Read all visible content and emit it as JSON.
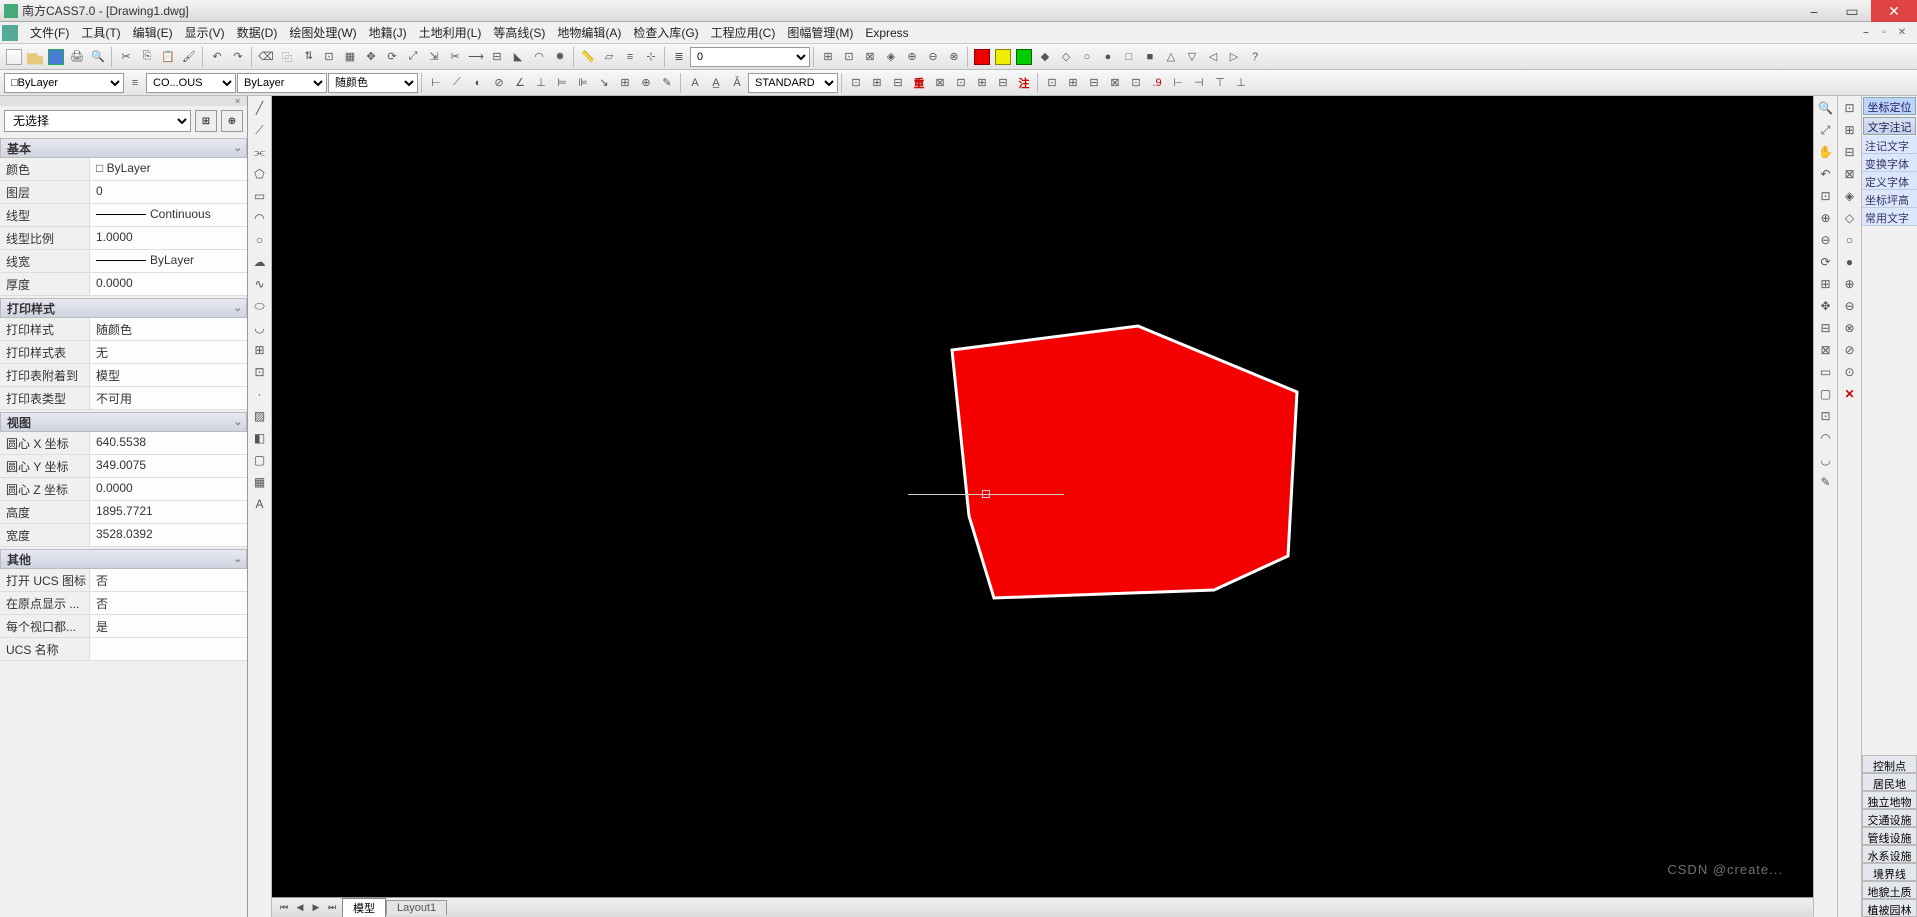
{
  "window": {
    "title": "南方CASS7.0 - [Drawing1.dwg]"
  },
  "menu": [
    "文件(F)",
    "工具(T)",
    "编辑(E)",
    "显示(V)",
    "数据(D)",
    "绘图处理(W)",
    "地籍(J)",
    "土地利用(L)",
    "等高线(S)",
    "地物编辑(A)",
    "检查入库(G)",
    "工程应用(C)",
    "图幅管理(M)",
    "Express"
  ],
  "layer_bar": {
    "layer_state": "0",
    "layer_combo": "□ByLayer",
    "linetype_combo": "CO...OUS",
    "lineweight_combo": "ByLayer",
    "color_combo": "随颜色",
    "textstyle": "STANDARD"
  },
  "properties": {
    "selector": "无选择",
    "sections": {
      "basic": {
        "title": "基本",
        "rows": [
          {
            "k": "颜色",
            "v": "□ ByLayer"
          },
          {
            "k": "图层",
            "v": "0"
          },
          {
            "k": "线型",
            "v": "Continuous",
            "line": true
          },
          {
            "k": "线型比例",
            "v": "1.0000"
          },
          {
            "k": "线宽",
            "v": "ByLayer",
            "line": true
          },
          {
            "k": "厚度",
            "v": "0.0000"
          }
        ]
      },
      "print": {
        "title": "打印样式",
        "rows": [
          {
            "k": "打印样式",
            "v": "随颜色"
          },
          {
            "k": "打印样式表",
            "v": "无"
          },
          {
            "k": "打印表附着到",
            "v": "模型"
          },
          {
            "k": "打印表类型",
            "v": "不可用"
          }
        ]
      },
      "view": {
        "title": "视图",
        "rows": [
          {
            "k": "圆心 X 坐标",
            "v": "640.5538"
          },
          {
            "k": "圆心 Y 坐标",
            "v": "349.0075"
          },
          {
            "k": "圆心 Z 坐标",
            "v": "0.0000"
          },
          {
            "k": "高度",
            "v": "1895.7721"
          },
          {
            "k": "宽度",
            "v": "3528.0392"
          }
        ]
      },
      "other": {
        "title": "其他",
        "rows": [
          {
            "k": "打开 UCS 图标",
            "v": "否"
          },
          {
            "k": "在原点显示 ...",
            "v": "否"
          },
          {
            "k": "每个视口都...",
            "v": "是"
          },
          {
            "k": "UCS 名称",
            "v": ""
          }
        ]
      }
    }
  },
  "tabs": {
    "model": "模型",
    "layout": "Layout1"
  },
  "right_top": {
    "tabs": [
      "坐标定位",
      "文字注记"
    ],
    "items": [
      "注记文字",
      "变换字体",
      "定义字体",
      "坐标坪高",
      "常用文字"
    ]
  },
  "right_cats": [
    "控制点",
    "居民地",
    "独立地物",
    "交通设施",
    "管线设施",
    "水系设施",
    "境界线",
    "地貌土质",
    "植被园林"
  ],
  "watermark": "CSDN @create..."
}
